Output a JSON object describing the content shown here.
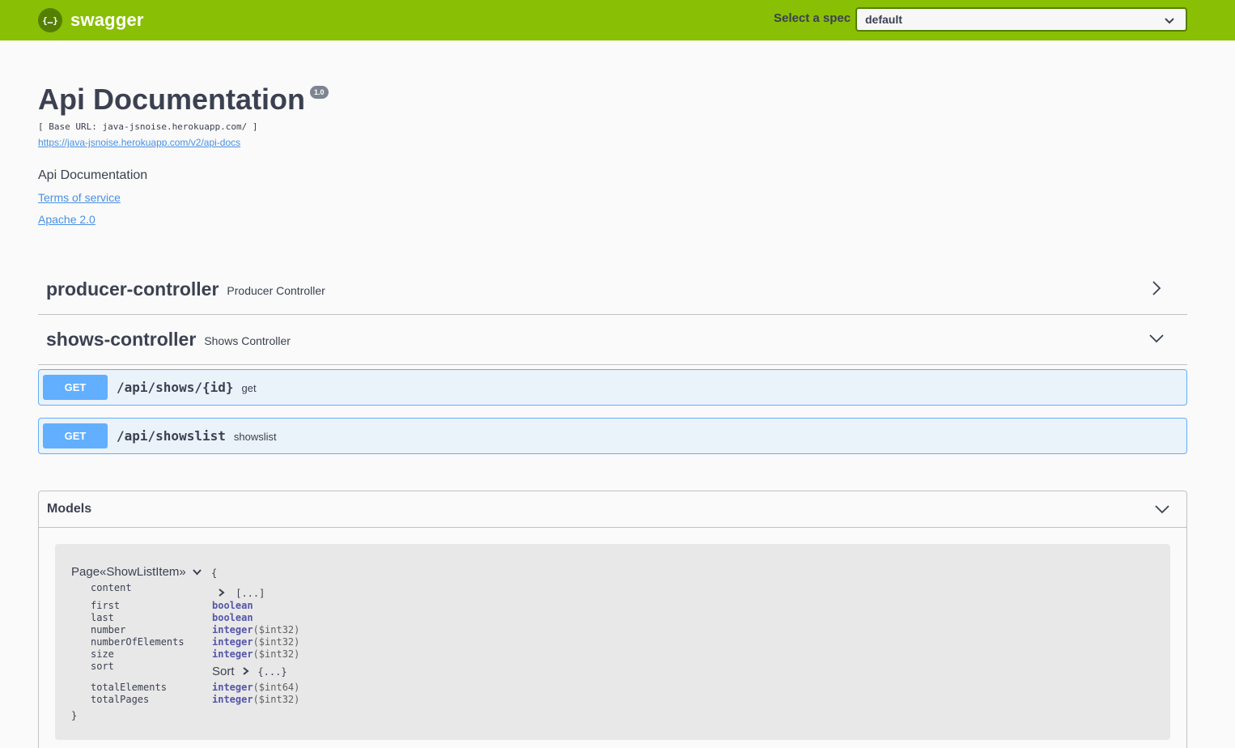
{
  "topbar": {
    "brand": "swagger",
    "select_label": "Select a spec",
    "select_value": "default"
  },
  "info": {
    "title": "Api Documentation",
    "version": "1.0",
    "base_url": "[ Base URL: java-jsnoise.herokuapp.com/ ]",
    "spec_link": "https://java-jsnoise.herokuapp.com/v2/api-docs",
    "description": "Api Documentation",
    "terms": "Terms of service",
    "license": "Apache 2.0"
  },
  "tags": [
    {
      "name": "producer-controller",
      "description": "Producer Controller",
      "expanded": false
    },
    {
      "name": "shows-controller",
      "description": "Shows Controller",
      "expanded": true
    }
  ],
  "operations": [
    {
      "method": "GET",
      "path": "/api/shows/{id}",
      "summary": "get"
    },
    {
      "method": "GET",
      "path": "/api/showslist",
      "summary": "showslist"
    }
  ],
  "models": {
    "title": "Models",
    "model_name": "Page«ShowListItem»",
    "brace_open": "{",
    "brace_close": "}",
    "collapsed_array": "[...]",
    "collapsed_object": "{...}",
    "properties": [
      {
        "name": "content",
        "type": "",
        "format": ""
      },
      {
        "name": "first",
        "type": "boolean",
        "format": ""
      },
      {
        "name": "last",
        "type": "boolean",
        "format": ""
      },
      {
        "name": "number",
        "type": "integer",
        "format": "($int32)"
      },
      {
        "name": "numberOfElements",
        "type": "integer",
        "format": "($int32)"
      },
      {
        "name": "size",
        "type": "integer",
        "format": "($int32)"
      },
      {
        "name": "sort",
        "type": "Sort",
        "format": ""
      },
      {
        "name": "totalElements",
        "type": "integer",
        "format": "($int64)"
      },
      {
        "name": "totalPages",
        "type": "integer",
        "format": "($int32)"
      }
    ]
  },
  "colors": {
    "topbar": "#89bf04",
    "get": "#61affe",
    "link": "#4990e2"
  }
}
